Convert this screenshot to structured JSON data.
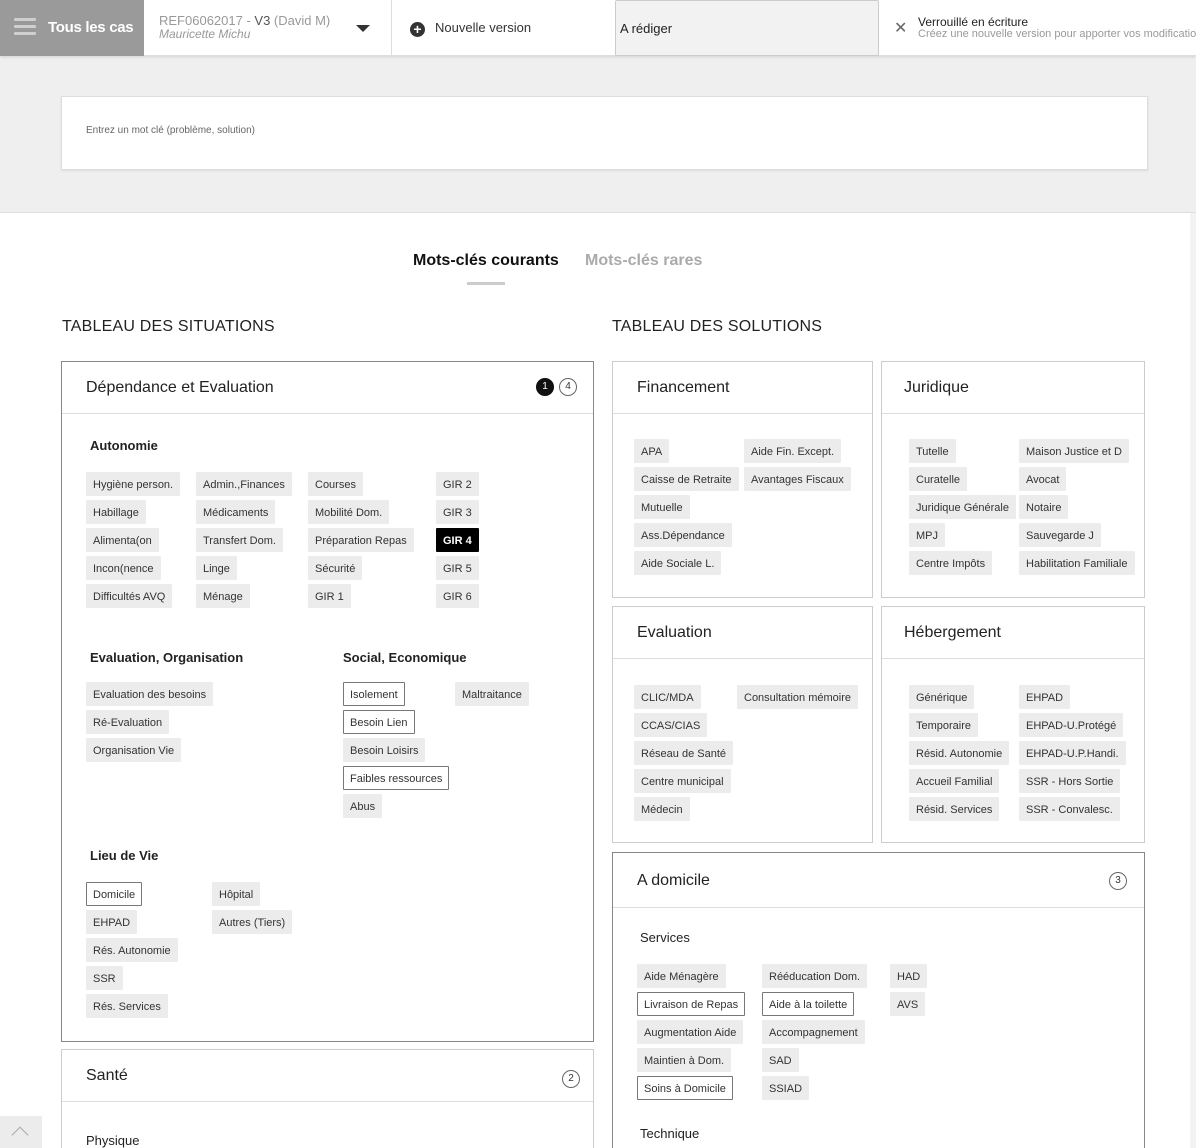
{
  "topbar": {
    "menu_label": "Tous les cas",
    "case": {
      "ref": "REF06062017 - ",
      "version": "V3",
      "author": " (David M)",
      "person": "Mauricette Michu"
    },
    "new_version_label": "Nouvelle version",
    "status_value": "A rédiger",
    "lock_title": "Verrouillé en écriture",
    "lock_subtitle": "Créez une nouvelle version pour apporter vos modifications"
  },
  "search": {
    "placeholder": "Entrez un mot clé (problème, solution)"
  },
  "tabs": {
    "current": "Mots-clés courants",
    "rare": "Mots-clés rares"
  },
  "situations": {
    "title": "TABLEAU DES SITUATIONS",
    "dependance": {
      "title": "Dépendance et Evaluation",
      "badge_selected": "1",
      "badge_total": "4",
      "autonomie": {
        "title": "Autonomie",
        "chips": [
          "Hygiène person.",
          "Admin.,Finances",
          "Courses",
          "GIR 2",
          "Habillage",
          "Médicaments",
          "Mobilité Dom.",
          "GIR 3",
          "Alimenta(on",
          "Transfert Dom.",
          "Préparation Repas",
          "GIR 4",
          "Incon(nence",
          "Linge",
          "Sécurité",
          "GIR 5",
          "Difficultés AVQ",
          "Ménage",
          "GIR 1",
          "GIR 6"
        ]
      },
      "evaluation": {
        "title": "Evaluation, Organisation",
        "chips": [
          "Evaluation des besoins",
          "Ré-Evaluation",
          "Organisation Vie"
        ]
      },
      "social": {
        "title": "Social, Economique",
        "chips": [
          "Isolement",
          "Maltraitance",
          "Besoin Lien",
          "Besoin Loisirs",
          "Faibles ressources",
          "Abus"
        ]
      },
      "lieu": {
        "title": "Lieu de Vie",
        "chips": [
          "Domicile",
          "Hôpital",
          "EHPAD",
          "Autres (Tiers)",
          "Rés. Autonomie",
          "SSR",
          "Rés. Services"
        ]
      }
    },
    "sante": {
      "title": "Santé",
      "badge_total": "2",
      "physique": "Physique"
    }
  },
  "solutions": {
    "title": "TABLEAU DES SOLUTIONS",
    "financement": {
      "title": "Financement",
      "chips": [
        "APA",
        "Aide Fin. Except.",
        "Caisse de Retraite",
        "Avantages Fiscaux",
        "Mutuelle",
        "Ass.Dépendance",
        "Aide Sociale L."
      ]
    },
    "juridique": {
      "title": "Juridique",
      "chips": [
        "Tutelle",
        "Maison Justice et D",
        "Curatelle",
        "Avocat",
        "Juridique Générale",
        "Notaire",
        "MPJ",
        "Sauvegarde J",
        "Centre Impôts",
        "Habilitation Familiale"
      ]
    },
    "evaluation": {
      "title": "Evaluation",
      "chips": [
        "CLIC/MDA",
        "Consultation mémoire",
        "CCAS/CIAS",
        "Réseau de Santé",
        "Centre municipal",
        "Médecin"
      ]
    },
    "hebergement": {
      "title": "Hébergement",
      "chips": [
        "Générique",
        "EHPAD",
        "Temporaire",
        "EHPAD-U.Protégé",
        "Résid. Autonomie",
        "EHPAD-U.P.Handi.",
        "Accueil Familial",
        "SSR - Hors Sortie",
        "Résid. Services",
        "SSR - Convalesc."
      ]
    },
    "domicile": {
      "title": "A domicile",
      "badge_total": "3",
      "services": {
        "title": "Services",
        "chips": [
          "Aide Ménagère",
          "Rééducation Dom.",
          "HAD",
          "Livraison de Repas",
          "Aide à la toilette",
          "AVS",
          "Augmentation Aide",
          "Accompagnement",
          "Maintien à Dom.",
          "SAD",
          "Soins à Domicile",
          "SSIAD"
        ]
      },
      "technique": "Technique"
    }
  }
}
